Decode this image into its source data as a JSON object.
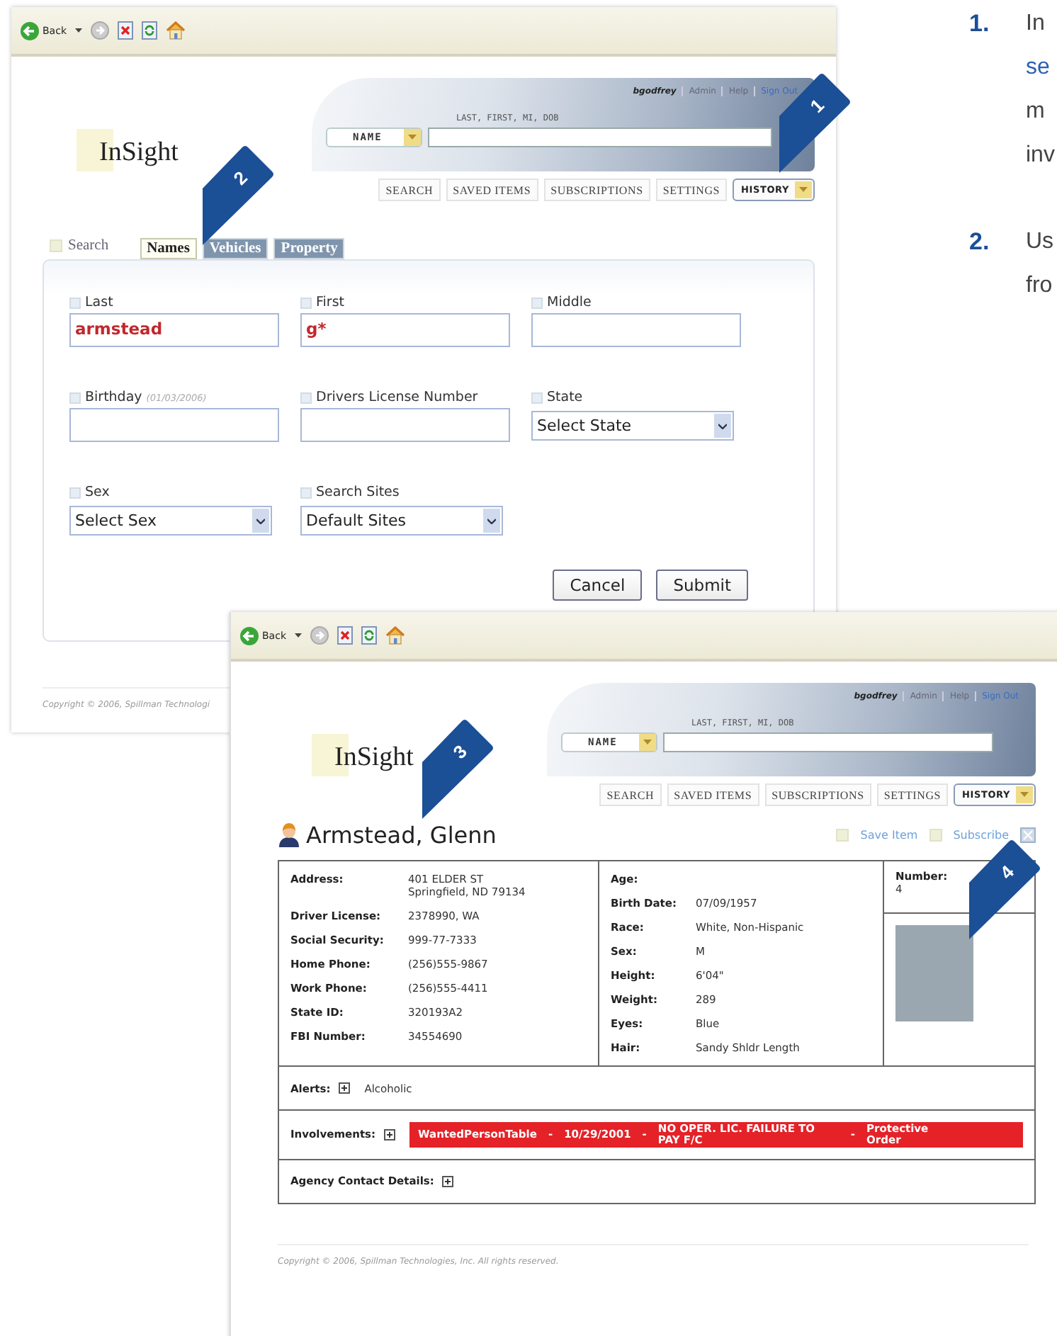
{
  "search_window": {
    "toolbar": {
      "back_label": "Back"
    },
    "header": {
      "user": "bgodfrey",
      "links": [
        "Admin",
        "Help",
        "Sign Out"
      ],
      "logo": "InSight",
      "search_hint": "LAST, FIRST, MI, DOB",
      "search_type": "NAME",
      "nav": [
        {
          "label": "SEARCH",
          "kind": "link"
        },
        {
          "label": "SAVED ITEMS",
          "kind": "link"
        },
        {
          "label": "SUBSCRIPTIONS",
          "kind": "link"
        },
        {
          "label": "SETTINGS",
          "kind": "link"
        },
        {
          "label": "HISTORY",
          "kind": "dropdown"
        }
      ]
    },
    "search_label": "Search",
    "tabs": [
      {
        "label": "Names",
        "selected": true
      },
      {
        "label": "Vehicles",
        "selected": false
      },
      {
        "label": "Property",
        "selected": false
      }
    ],
    "fields": [
      {
        "kind": "text",
        "label": "Last",
        "checked": false,
        "value": "armstead"
      },
      {
        "kind": "text",
        "label": "First",
        "checked": false,
        "value": "g*"
      },
      {
        "kind": "text",
        "label": "Middle",
        "checked": false
      },
      {
        "kind": "text",
        "label": "Birthday",
        "hint": "(01/03/2006)",
        "checked": false
      },
      {
        "kind": "text",
        "label": "Drivers License Number",
        "checked": false
      },
      {
        "kind": "select",
        "label": "State",
        "checked": false,
        "value": "Select State"
      },
      {
        "kind": "select",
        "label": "Sex",
        "checked": false,
        "value": "Select Sex"
      },
      {
        "kind": "select",
        "label": "Search Sites",
        "checked": false,
        "value": "Default Sites"
      }
    ],
    "buttons": [
      "Cancel",
      "Submit"
    ],
    "footer": "Copyright © 2006, Spillman Technologi"
  },
  "record_window": {
    "toolbar": {
      "back_label": "Back"
    },
    "header": {
      "user": "bgodfrey",
      "links": [
        "Admin",
        "Help",
        "Sign Out"
      ],
      "logo": "InSight",
      "search_hint": "LAST, FIRST, MI, DOB",
      "search_type": "NAME",
      "nav": [
        {
          "label": "SEARCH",
          "kind": "link"
        },
        {
          "label": "SAVED ITEMS",
          "kind": "link"
        },
        {
          "label": "SUBSCRIPTIONS",
          "kind": "link"
        },
        {
          "label": "SETTINGS",
          "kind": "link"
        },
        {
          "label": "HISTORY",
          "kind": "dropdown"
        }
      ]
    },
    "person": {
      "name": "Armstead, Glenn",
      "actions": [
        "Save Item",
        "Subscribe"
      ]
    },
    "details": {
      "identity": [
        {
          "label": "Address:",
          "lines": [
            "401 ELDER ST",
            "Springfield, ND 79134"
          ]
        },
        {
          "label": "Driver License:",
          "lines": [
            "2378990, WA"
          ]
        },
        {
          "label": "Social Security:",
          "lines": [
            "999-77-7333"
          ]
        },
        {
          "label": "Home Phone:",
          "lines": [
            "(256)555-9867"
          ]
        },
        {
          "label": "Work Phone:",
          "lines": [
            "(256)555-4411"
          ]
        },
        {
          "label": "State ID:",
          "lines": [
            "320193A2"
          ]
        },
        {
          "label": "FBI Number:",
          "lines": [
            "34554690"
          ]
        }
      ],
      "physical": [
        {
          "label": "Age:"
        },
        {
          "label": "Birth Date:",
          "lines": [
            "07/09/1957"
          ]
        },
        {
          "label": "Race:",
          "lines": [
            "White, Non-Hispanic"
          ]
        },
        {
          "label": "Sex:",
          "lines": [
            "M"
          ]
        },
        {
          "label": "Height:",
          "lines": [
            "6'04\""
          ]
        },
        {
          "label": "Weight:",
          "lines": [
            "289"
          ]
        },
        {
          "label": "Eyes:",
          "lines": [
            "Blue"
          ]
        },
        {
          "label": "Hair:",
          "lines": [
            "Sandy Shldr Length"
          ]
        }
      ],
      "number": {
        "label": "Number:",
        "value": "4"
      }
    },
    "sections": [
      {
        "kind": "alerts",
        "label": "Alerts:",
        "expanded": false,
        "value": "Alcoholic"
      },
      {
        "kind": "involvements",
        "label": "Involvements:",
        "expanded": false,
        "parts": [
          "WantedPersonTable",
          "-",
          "10/29/2001",
          "-",
          "NO OPER. LIC. FAILURE TO PAY F/C",
          "-",
          "Protective Order"
        ]
      },
      {
        "kind": "agency",
        "label": "Agency Contact Details:",
        "expanded": false
      }
    ],
    "footer": "Copyright © 2006, Spillman Technologies, Inc. All rights reserved."
  },
  "callouts": [
    {
      "number": "1"
    },
    {
      "number": "2"
    },
    {
      "number": "3"
    },
    {
      "number": "4"
    }
  ],
  "side_notes": [
    {
      "number": "1.",
      "lines": [
        {
          "kind": "plain",
          "text": "In"
        },
        {
          "kind": "link",
          "text": "se"
        },
        {
          "kind": "plain",
          "text": "m"
        },
        {
          "kind": "plain",
          "text": "inv"
        }
      ]
    },
    {
      "number": "2.",
      "lines": [
        {
          "kind": "plain",
          "text": "Us"
        },
        {
          "kind": "plain",
          "text": "fro"
        }
      ]
    }
  ]
}
